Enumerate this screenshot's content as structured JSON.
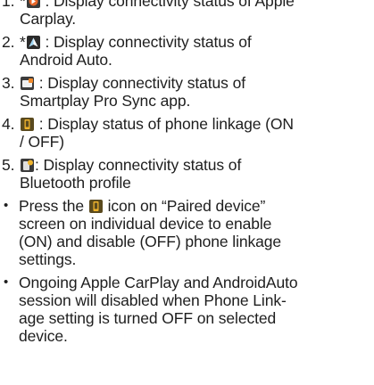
{
  "doc": {
    "items": [
      {
        "num": "1.",
        "star": "*",
        "lines": [
          ": Display connectivity status of Apple",
          "Carplay."
        ]
      },
      {
        "num": "2.",
        "star": "*",
        "lines": [
          ": Display connectivity status of",
          "Android Auto."
        ]
      },
      {
        "num": "3.",
        "lines": [
          ": Display connectivity status of",
          "Smartplay Pro Sync app."
        ]
      },
      {
        "num": "4.",
        "lines": [
          ": Display status of phone linkage (ON",
          "/ OFF)"
        ]
      },
      {
        "num": "5.",
        "lines": [
          ": Display connectivity status of",
          "Bluetooth profile"
        ]
      }
    ],
    "bullets": [
      {
        "pre": "Press the",
        "post": "icon on “Paired device”",
        "lines": [
          "screen on individual device to enable",
          "(ON) and disable (OFF) phone linkage",
          "settings."
        ]
      },
      {
        "lines": [
          "Ongoing Apple CarPlay and AndroidAuto",
          "session will disabled when Phone Link-",
          "age setting is turned OFF on selected",
          "device."
        ]
      }
    ],
    "bullet_char": "•"
  },
  "colors": {
    "text": "#1e1e1e",
    "carplay_icon_bg": "#3a3a3a",
    "carplay_icon_accent": "#e8672a",
    "android_icon_bg": "#2b2b2b",
    "sync_icon_bg": "#3c3c3c",
    "sync_icon_accent": "#f08a2c",
    "phone_icon_bg": "#5a4a1e",
    "phone_icon_accent": "#f0b42c"
  },
  "icons": [
    "carplay-icon",
    "android-auto-icon",
    "smartplay-sync-icon",
    "phone-linkage-icon",
    "bluetooth-profile-icon"
  ]
}
